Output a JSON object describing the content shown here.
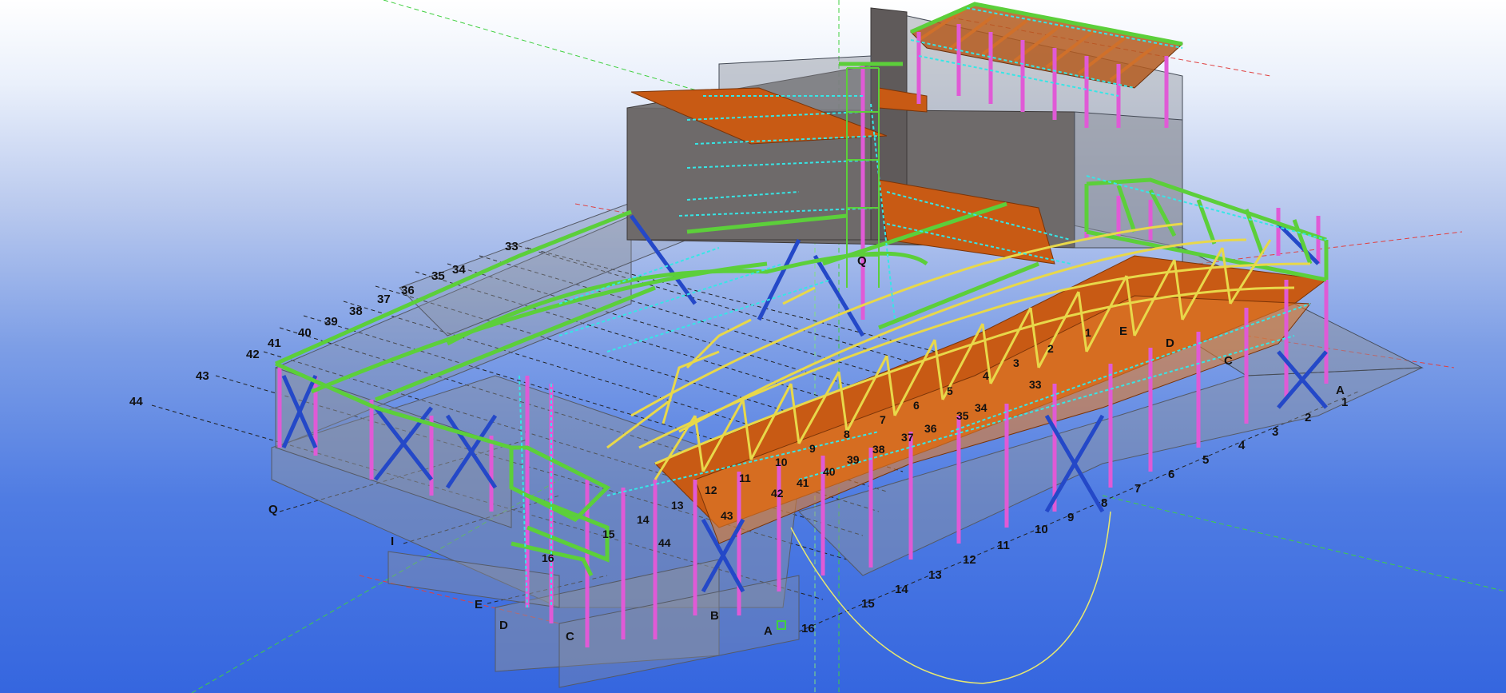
{
  "colors": {
    "concrete": "#6e6a6a",
    "concrete_glass": "#8e929c",
    "slab": "#c85a14",
    "slab_light": "#e07a2a",
    "beam_green": "#5ccf3a",
    "beam_cyan": "#36e6e6",
    "column_magenta": "#e05ad6",
    "brace_blue": "#2448c8",
    "truss_yellow": "#e8d84a",
    "roof_brown": "#b45a1e",
    "grid_line_black": "#222222",
    "grid_line_red": "#e04040",
    "grid_line_green": "#40d040",
    "ring_yellow": "#e8e870"
  },
  "grid_labels": {
    "left_axis": [
      "33",
      "34",
      "35",
      "36",
      "37",
      "38",
      "39",
      "40",
      "41",
      "42",
      "43",
      "44"
    ],
    "left_letters": [
      "Q",
      "I",
      "E",
      "D",
      "C",
      "B",
      "A"
    ],
    "front_axis": [
      "16",
      "15",
      "14",
      "13",
      "12",
      "11",
      "10",
      "9",
      "8",
      "7",
      "6",
      "5",
      "4",
      "3",
      "2",
      "1"
    ],
    "right_letters": [
      "A",
      "C",
      "D",
      "E"
    ],
    "roof_numbers": [
      "1",
      "2",
      "3",
      "4",
      "5",
      "6",
      "7",
      "8",
      "9",
      "10",
      "11",
      "12",
      "13",
      "14",
      "15",
      "16",
      "33",
      "34",
      "35",
      "36",
      "37",
      "38",
      "39",
      "40",
      "41",
      "42",
      "43",
      "44"
    ],
    "top_letter": "Q"
  }
}
